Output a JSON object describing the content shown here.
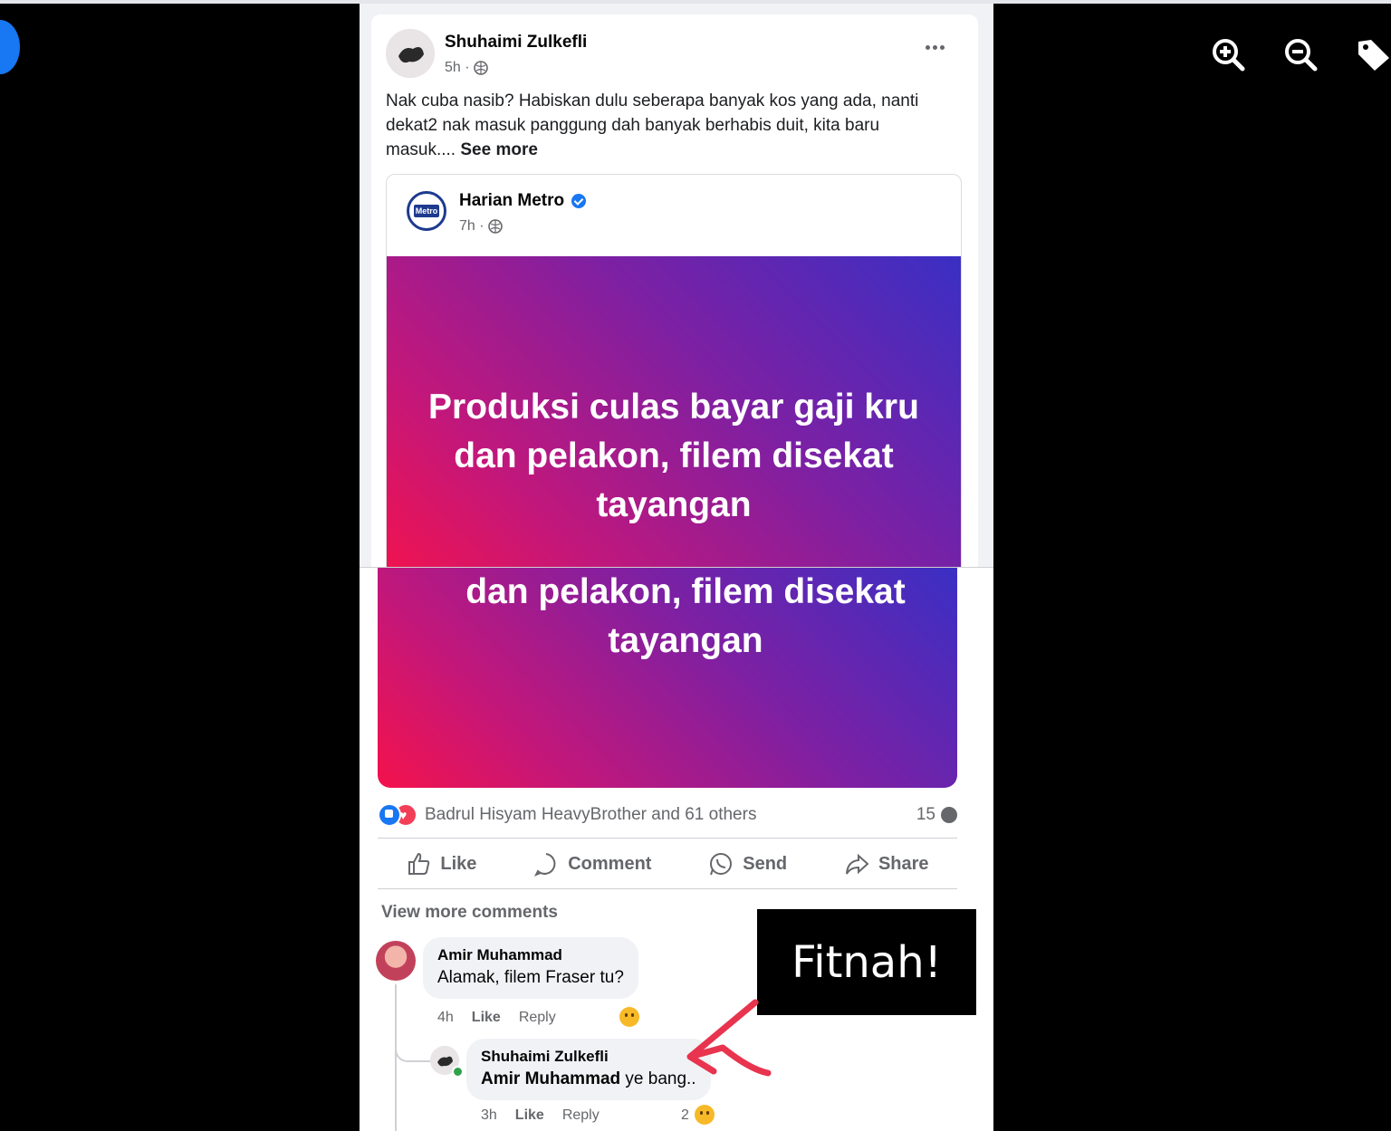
{
  "viewer": {
    "tools": [
      {
        "name": "zoom-in-icon"
      },
      {
        "name": "zoom-out-icon"
      },
      {
        "name": "tag-icon"
      }
    ]
  },
  "post": {
    "author": "Shuhaimi Zulkefli",
    "time": "5h ·",
    "text": "Nak cuba nasib? Habiskan dulu seberapa banyak kos yang ada, nanti dekat2 nak masuk panggung dah banyak berhabis duit, kita baru masuk....",
    "see_more": "See more"
  },
  "shared": {
    "page_name": "Harian Metro",
    "logo_text": "Metro",
    "time": "7h ·",
    "headline": "Produksi culas bayar gaji kru dan pelakon, filem disekat tayangan",
    "headline_lower": "dan pelakon, filem disekat tayangan"
  },
  "reactions": {
    "names": "Badrul Hisyam HeavyBrother and 61 others",
    "comment_count": "15"
  },
  "actions": {
    "like": "Like",
    "comment": "Comment",
    "send": "Send",
    "share": "Share"
  },
  "comments": {
    "view_more": "View more comments",
    "c1": {
      "name": "Amir Muhammad",
      "text": "Alamak, filem Fraser tu?",
      "time": "4h",
      "like": "Like",
      "reply": "Reply"
    },
    "c2": {
      "name": "Shuhaimi Zulkefli",
      "mention": "Amir Muhammad",
      "text": " ye bang..",
      "time": "3h",
      "like": "Like",
      "reply": "Reply",
      "reaction_count": "2"
    }
  },
  "annotation": {
    "label": "Fitnah!",
    "arrow_color": "#e8344e"
  }
}
